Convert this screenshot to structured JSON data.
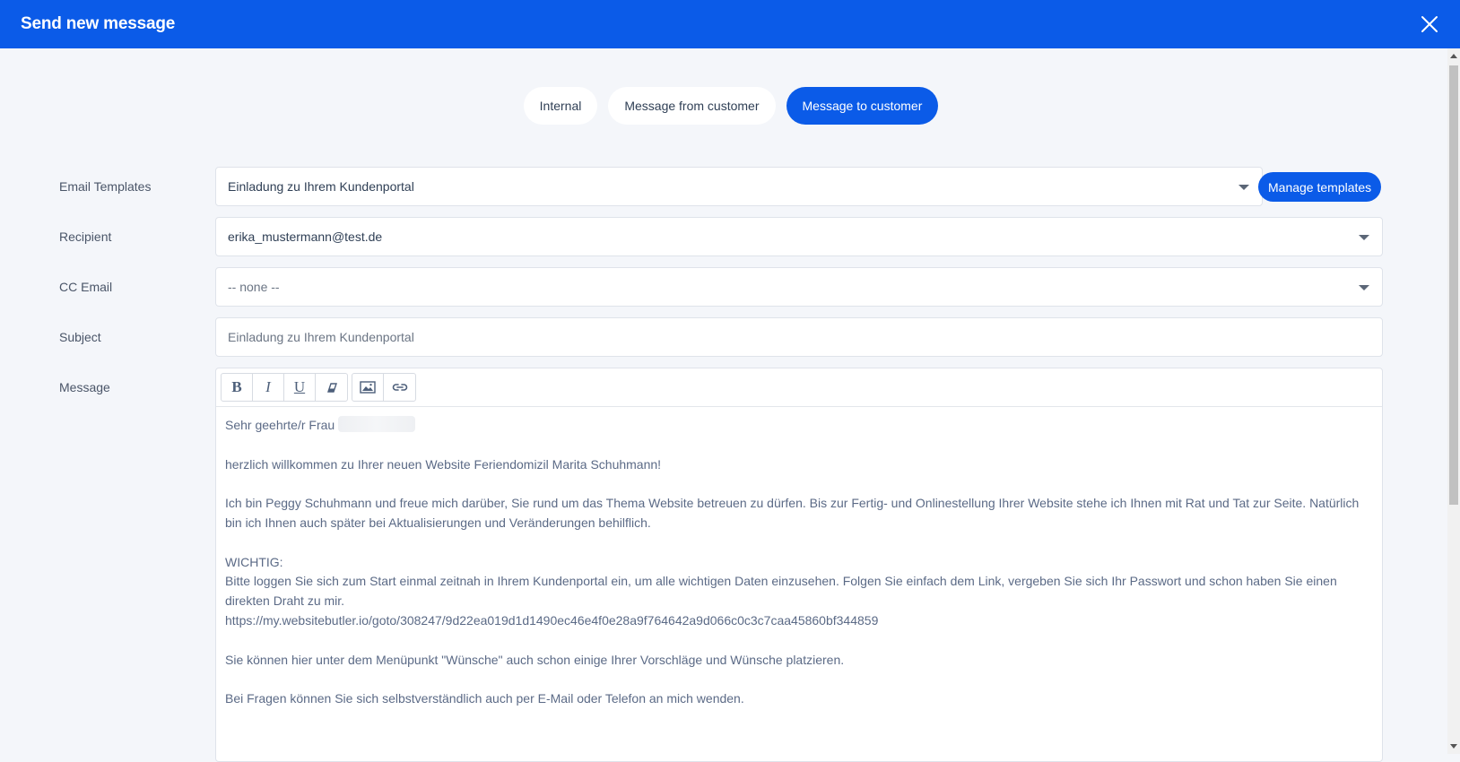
{
  "header": {
    "title": "Send new message",
    "close_icon": "close-icon"
  },
  "tabs": [
    {
      "label": "Internal",
      "active": false
    },
    {
      "label": "Message from customer",
      "active": false
    },
    {
      "label": "Message to customer",
      "active": true
    }
  ],
  "form": {
    "email_templates": {
      "label": "Email Templates",
      "value": "Einladung zu Ihrem Kundenportal"
    },
    "manage_templates_label": "Manage templates",
    "recipient": {
      "label": "Recipient",
      "value": "erika_mustermann@test.de"
    },
    "cc_email": {
      "label": "CC Email",
      "value": "-- none --"
    },
    "subject": {
      "label": "Subject",
      "value": "Einladung zu Ihrem Kundenportal"
    },
    "message": {
      "label": "Message"
    }
  },
  "toolbar": {
    "bold": "B",
    "italic": "I",
    "underline": "U",
    "icons": [
      "bold-icon",
      "italic-icon",
      "underline-icon",
      "eraser-icon",
      "image-icon",
      "link-icon"
    ]
  },
  "message_body": {
    "greeting": "Sehr geehrte/r Frau",
    "welcome": "herzlich willkommen zu Ihrer neuen Website Feriendomizil Marita Schuhmann!",
    "intro_1": "Ich bin Peggy Schuhmann und freue mich darüber, Sie rund um das Thema Website betreuen zu dürfen. Bis zur Fertig- und Onlinestellung Ihrer Website stehe ich Ihnen mit Rat und Tat zur Seite. Natürlich",
    "intro_2": "bin ich Ihnen auch später bei Aktualisierungen und Veränderungen behilflich.",
    "important": "WICHTIG:",
    "login_1": "Bitte loggen Sie sich zum Start einmal zeitnah in Ihrem Kundenportal ein, um alle wichtigen Daten einzusehen. Folgen Sie einfach dem Link, vergeben Sie sich Ihr Passwort und schon haben Sie einen",
    "login_2": "direkten Draht zu mir.",
    "link": "https://my.websitebutler.io/goto/308247/9d22ea019d1d1490ec46e4f0e28a9f764642a9d066c0c3c7caa45860bf344859",
    "wishes": "Sie können hier unter dem Menüpunkt \"Wünsche\" auch schon einige Ihrer Vorschläge und Wünsche platzieren.",
    "questions": "Bei Fragen können Sie sich selbstverständlich auch per E-Mail oder Telefon an mich wenden."
  },
  "colors": {
    "accent": "#0b5be8",
    "background": "#f4f6fa",
    "text": "#3b4a5e"
  }
}
